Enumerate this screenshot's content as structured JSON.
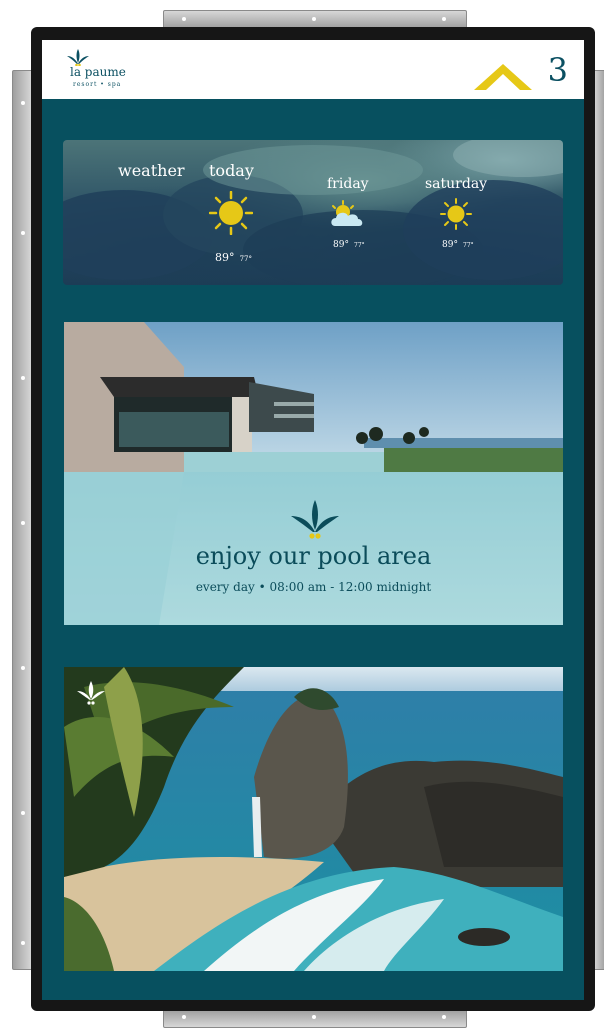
{
  "header": {
    "brand_name": "la paume",
    "brand_tagline": "resort • spa",
    "page_number": "3"
  },
  "weather": {
    "section_label": "weather",
    "days": [
      {
        "day": "today",
        "icon": "sun-icon",
        "high": "89°",
        "low": "77°"
      },
      {
        "day": "friday",
        "icon": "partly-cloudy-icon",
        "high": "89°",
        "low": "77°"
      },
      {
        "day": "saturday",
        "icon": "sun-icon",
        "high": "89°",
        "low": "77°"
      }
    ]
  },
  "pool": {
    "title": "enjoy our pool area",
    "hours": "every day • 08:00 am - 12:00 midnight"
  },
  "colors": {
    "screen_background": "#07505f",
    "brand_teal": "#0b5062",
    "brand_yellow": "#e6c817",
    "header_background": "#ffffff"
  }
}
